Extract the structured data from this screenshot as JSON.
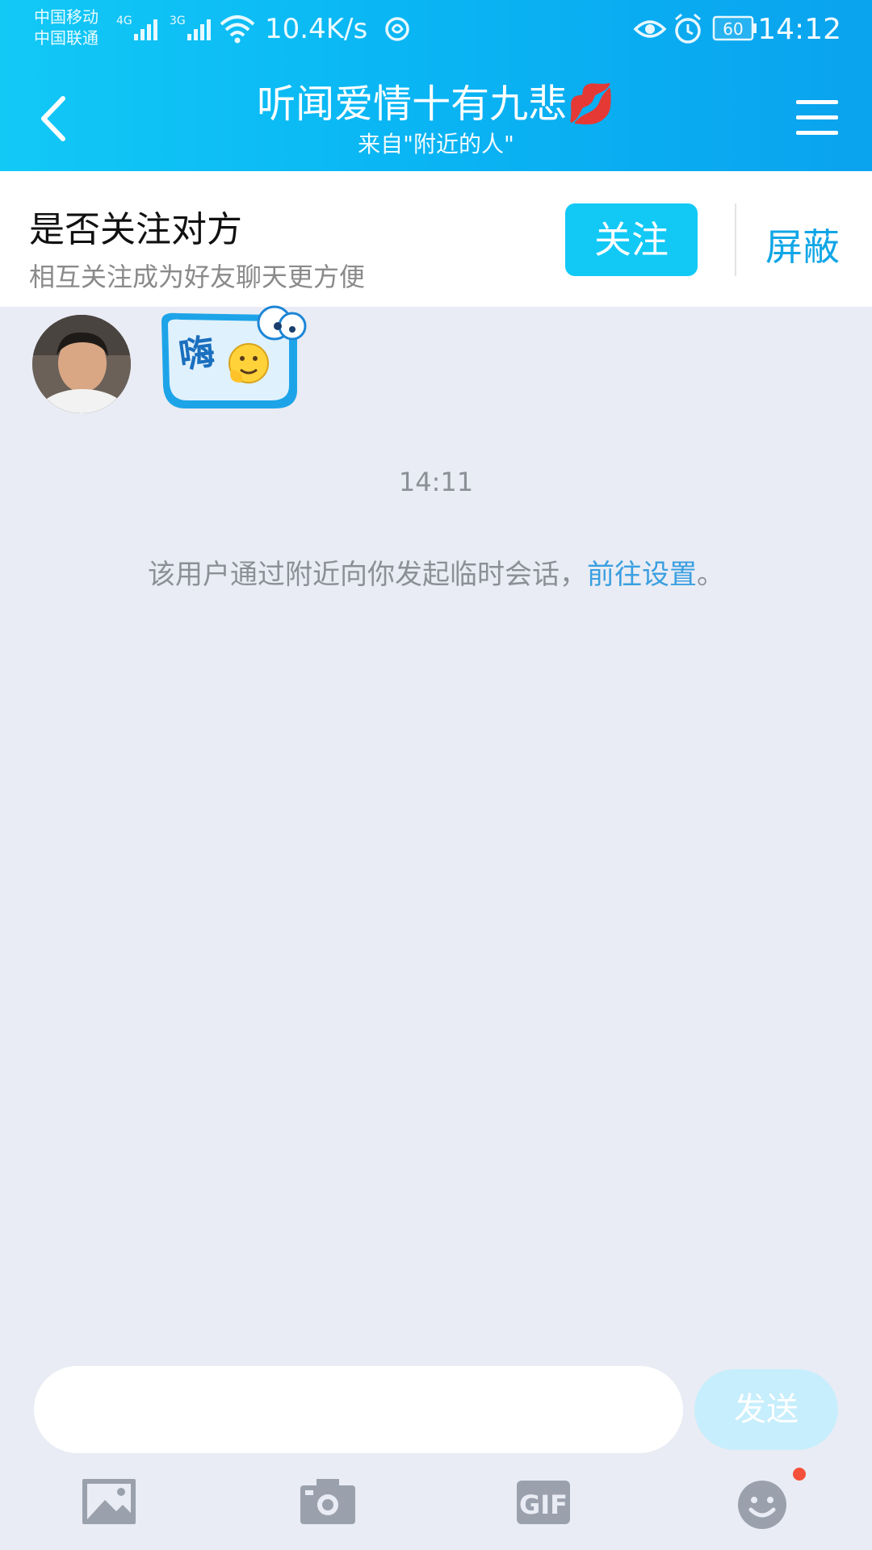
{
  "status_bar": {
    "carrier_1": "中国移动",
    "carrier_2": "中国联通",
    "network_1": "4G",
    "network_2": "3G",
    "net_speed": "10.4K/s",
    "battery": "60",
    "time": "14:12"
  },
  "header": {
    "title": "听闻爱情十有九悲💋",
    "subtitle": "来自\"附近的人\""
  },
  "follow_bar": {
    "title": "是否关注对方",
    "subtitle": "相互关注成为好友聊天更方便",
    "follow_label": "关注",
    "block_label": "屏蔽"
  },
  "chat": {
    "sticker_text": "嗨",
    "timestamp": "14:11",
    "system_message": "该用户通过附近向你发起临时会话，",
    "system_link": "前往设置",
    "system_end": "。"
  },
  "input": {
    "placeholder": "",
    "send_label": "发送"
  },
  "toolbar": {
    "gif_label": "GIF"
  },
  "colors": {
    "accent": "#12c9f6",
    "link": "#3a9fe0",
    "background": "#e9ecf4"
  }
}
